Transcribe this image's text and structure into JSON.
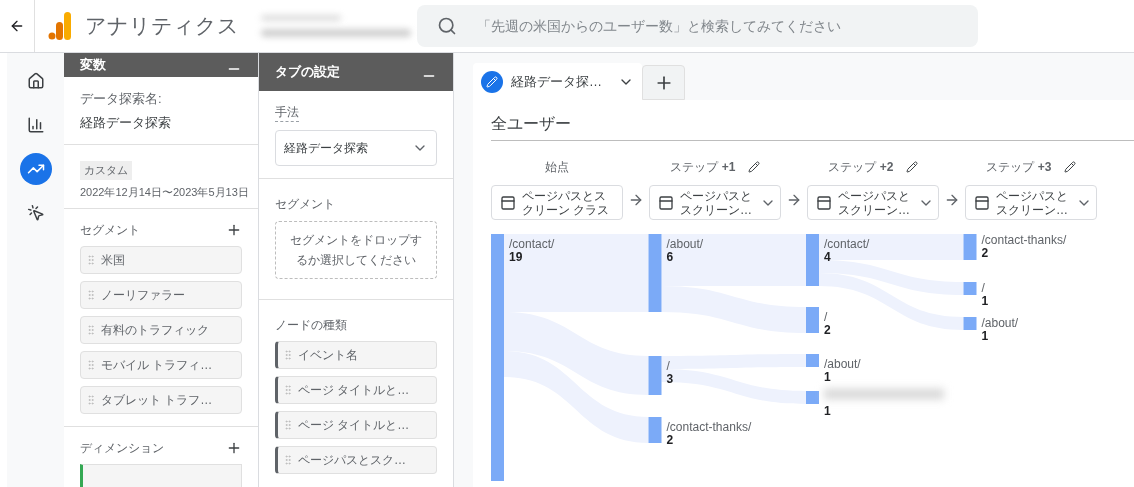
{
  "app": {
    "title": "アナリティクス"
  },
  "search": {
    "placeholder": "「先週の米国からのユーザー数」と検索してみてください"
  },
  "nav": [
    {
      "kind": "home",
      "selected": false
    },
    {
      "kind": "reports",
      "selected": false
    },
    {
      "kind": "explore",
      "selected": true
    },
    {
      "kind": "advertising",
      "selected": false
    }
  ],
  "variables_panel": {
    "title": "変数",
    "name_label": "データ探索名:",
    "name": "経路データ探索",
    "date_badge": "カスタム",
    "date_range": "2022年12月14日〜2023年5月13日",
    "segments_heading": "セグメント",
    "segments": [
      "米国",
      "ノーリファラー",
      "有料のトラフィック",
      "モバイル トラフィ…",
      "タブレット トラフ…"
    ],
    "dimensions_heading": "ディメンション"
  },
  "settings_panel": {
    "title": "タブの設定",
    "technique_label": "手法",
    "technique": "経路データ探索",
    "segment_heading": "セグメント",
    "segment_drop": "セグメントをドロップするか選択してください",
    "node_types_heading": "ノードの種類",
    "node_types": [
      "イベント名",
      "ページ タイトルと…",
      "ページ タイトルと…",
      "ページパスとスク…"
    ]
  },
  "tabs": [
    {
      "label": "経路データ探…",
      "selected": true
    }
  ],
  "segment_title": "全ユーザー",
  "steps": [
    {
      "header": "始点",
      "editable": false,
      "dimension": "ページパスとスクリーン クラス",
      "dropdown": false,
      "nodes": [
        {
          "label": "/contact/",
          "value": "19"
        }
      ]
    },
    {
      "header": "ステップ **+1**",
      "editable": true,
      "dimension": "ページパスとスクリーン…",
      "dropdown": true,
      "nodes": [
        {
          "label": "/about/",
          "value": "6"
        },
        {
          "label": "/",
          "value": "3"
        },
        {
          "label": "/contact-thanks/",
          "value": "2"
        }
      ]
    },
    {
      "header": "ステップ **+2**",
      "editable": true,
      "dimension": "ページパスとスクリーン…",
      "dropdown": true,
      "nodes": [
        {
          "label": "/contact/",
          "value": "4"
        },
        {
          "label": "/",
          "value": "2"
        },
        {
          "label": "/about/",
          "value": "1"
        },
        {
          "value": "1"
        }
      ]
    },
    {
      "header": "ステップ **+3**",
      "editable": true,
      "dimension": "ページパスとスクリーン…",
      "dropdown": true,
      "nodes": [
        {
          "label": "/contact-thanks/",
          "value": "2"
        },
        {
          "label": "/",
          "value": "1"
        },
        {
          "label": "/about/",
          "value": "1"
        }
      ]
    }
  ]
}
